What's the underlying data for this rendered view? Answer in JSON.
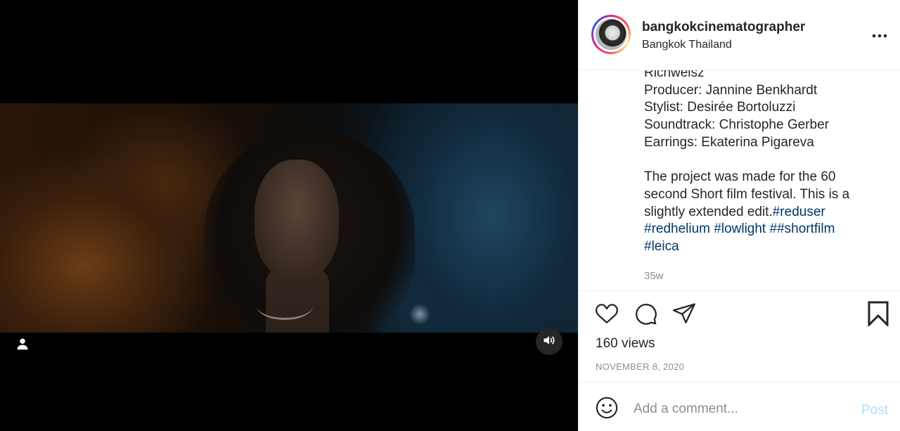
{
  "post": {
    "username": "bangkokcinematographer",
    "location": "Bangkok Thailand"
  },
  "caption": {
    "credits": [
      "Richweisz",
      "Producer: Jannine Benkhardt",
      "Stylist: Desirée Bortoluzzi",
      "Soundtrack: Christophe Gerber",
      "Earrings: Ekaterina Pigareva"
    ],
    "body_lines": [
      "The project was made for the 60",
      "second Short film festival. This is a",
      "slightly extended edit."
    ],
    "hashtags": [
      "#reduser",
      "#redhelium",
      "#lowlight",
      "##shortfilm",
      "#leica"
    ],
    "age": "35w"
  },
  "stats": {
    "views": "160 views",
    "date": "NOVEMBER 8, 2020"
  },
  "comment_box": {
    "placeholder": "Add a comment...",
    "post_label": "Post"
  },
  "colors": {
    "link": "#00376b",
    "muted": "#8e8e8e",
    "post_disabled": "#b2dffc"
  },
  "icons": {
    "more": "more-dots-icon",
    "like": "heart-icon",
    "comment": "comment-bubble-icon",
    "share": "paper-plane-icon",
    "save": "bookmark-icon",
    "emoji": "smiley-icon",
    "user_tag": "user-icon",
    "audio": "speaker-icon"
  }
}
